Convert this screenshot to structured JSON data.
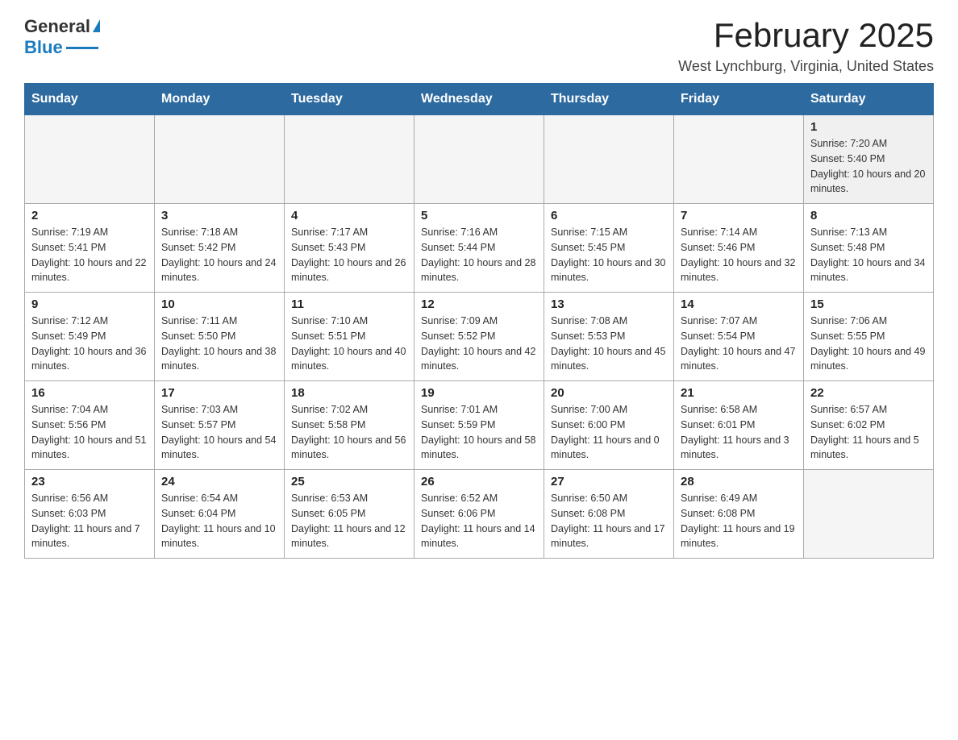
{
  "header": {
    "logo": {
      "general": "General",
      "blue": "Blue"
    },
    "title": "February 2025",
    "location": "West Lynchburg, Virginia, United States"
  },
  "days_of_week": [
    "Sunday",
    "Monday",
    "Tuesday",
    "Wednesday",
    "Thursday",
    "Friday",
    "Saturday"
  ],
  "weeks": [
    [
      {
        "day": "",
        "info": ""
      },
      {
        "day": "",
        "info": ""
      },
      {
        "day": "",
        "info": ""
      },
      {
        "day": "",
        "info": ""
      },
      {
        "day": "",
        "info": ""
      },
      {
        "day": "",
        "info": ""
      },
      {
        "day": "1",
        "info": "Sunrise: 7:20 AM\nSunset: 5:40 PM\nDaylight: 10 hours and 20 minutes."
      }
    ],
    [
      {
        "day": "2",
        "info": "Sunrise: 7:19 AM\nSunset: 5:41 PM\nDaylight: 10 hours and 22 minutes."
      },
      {
        "day": "3",
        "info": "Sunrise: 7:18 AM\nSunset: 5:42 PM\nDaylight: 10 hours and 24 minutes."
      },
      {
        "day": "4",
        "info": "Sunrise: 7:17 AM\nSunset: 5:43 PM\nDaylight: 10 hours and 26 minutes."
      },
      {
        "day": "5",
        "info": "Sunrise: 7:16 AM\nSunset: 5:44 PM\nDaylight: 10 hours and 28 minutes."
      },
      {
        "day": "6",
        "info": "Sunrise: 7:15 AM\nSunset: 5:45 PM\nDaylight: 10 hours and 30 minutes."
      },
      {
        "day": "7",
        "info": "Sunrise: 7:14 AM\nSunset: 5:46 PM\nDaylight: 10 hours and 32 minutes."
      },
      {
        "day": "8",
        "info": "Sunrise: 7:13 AM\nSunset: 5:48 PM\nDaylight: 10 hours and 34 minutes."
      }
    ],
    [
      {
        "day": "9",
        "info": "Sunrise: 7:12 AM\nSunset: 5:49 PM\nDaylight: 10 hours and 36 minutes."
      },
      {
        "day": "10",
        "info": "Sunrise: 7:11 AM\nSunset: 5:50 PM\nDaylight: 10 hours and 38 minutes."
      },
      {
        "day": "11",
        "info": "Sunrise: 7:10 AM\nSunset: 5:51 PM\nDaylight: 10 hours and 40 minutes."
      },
      {
        "day": "12",
        "info": "Sunrise: 7:09 AM\nSunset: 5:52 PM\nDaylight: 10 hours and 42 minutes."
      },
      {
        "day": "13",
        "info": "Sunrise: 7:08 AM\nSunset: 5:53 PM\nDaylight: 10 hours and 45 minutes."
      },
      {
        "day": "14",
        "info": "Sunrise: 7:07 AM\nSunset: 5:54 PM\nDaylight: 10 hours and 47 minutes."
      },
      {
        "day": "15",
        "info": "Sunrise: 7:06 AM\nSunset: 5:55 PM\nDaylight: 10 hours and 49 minutes."
      }
    ],
    [
      {
        "day": "16",
        "info": "Sunrise: 7:04 AM\nSunset: 5:56 PM\nDaylight: 10 hours and 51 minutes."
      },
      {
        "day": "17",
        "info": "Sunrise: 7:03 AM\nSunset: 5:57 PM\nDaylight: 10 hours and 54 minutes."
      },
      {
        "day": "18",
        "info": "Sunrise: 7:02 AM\nSunset: 5:58 PM\nDaylight: 10 hours and 56 minutes."
      },
      {
        "day": "19",
        "info": "Sunrise: 7:01 AM\nSunset: 5:59 PM\nDaylight: 10 hours and 58 minutes."
      },
      {
        "day": "20",
        "info": "Sunrise: 7:00 AM\nSunset: 6:00 PM\nDaylight: 11 hours and 0 minutes."
      },
      {
        "day": "21",
        "info": "Sunrise: 6:58 AM\nSunset: 6:01 PM\nDaylight: 11 hours and 3 minutes."
      },
      {
        "day": "22",
        "info": "Sunrise: 6:57 AM\nSunset: 6:02 PM\nDaylight: 11 hours and 5 minutes."
      }
    ],
    [
      {
        "day": "23",
        "info": "Sunrise: 6:56 AM\nSunset: 6:03 PM\nDaylight: 11 hours and 7 minutes."
      },
      {
        "day": "24",
        "info": "Sunrise: 6:54 AM\nSunset: 6:04 PM\nDaylight: 11 hours and 10 minutes."
      },
      {
        "day": "25",
        "info": "Sunrise: 6:53 AM\nSunset: 6:05 PM\nDaylight: 11 hours and 12 minutes."
      },
      {
        "day": "26",
        "info": "Sunrise: 6:52 AM\nSunset: 6:06 PM\nDaylight: 11 hours and 14 minutes."
      },
      {
        "day": "27",
        "info": "Sunrise: 6:50 AM\nSunset: 6:08 PM\nDaylight: 11 hours and 17 minutes."
      },
      {
        "day": "28",
        "info": "Sunrise: 6:49 AM\nSunset: 6:08 PM\nDaylight: 11 hours and 19 minutes."
      },
      {
        "day": "",
        "info": ""
      }
    ]
  ]
}
